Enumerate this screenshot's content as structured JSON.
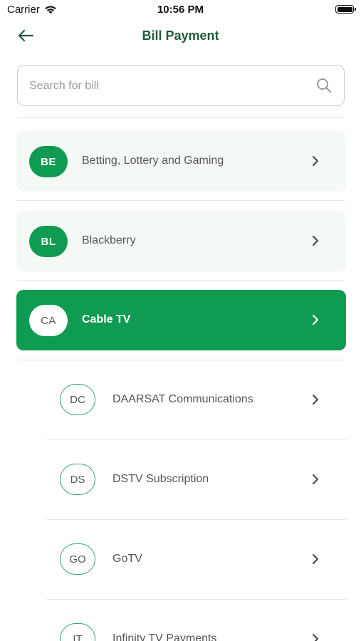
{
  "status_bar": {
    "carrier": "Carrier",
    "time": "10:56 PM"
  },
  "nav": {
    "title": "Bill Payment"
  },
  "search": {
    "placeholder": "Search for bill"
  },
  "categories": [
    {
      "code": "BE",
      "label": "Betting, Lottery and Gaming"
    },
    {
      "code": "BL",
      "label": "Blackberry"
    },
    {
      "code": "CA",
      "label": "Cable TV"
    }
  ],
  "sub_items": [
    {
      "code": "DC",
      "label": "DAARSAT Communications"
    },
    {
      "code": "DS",
      "label": "DSTV Subscription"
    },
    {
      "code": "GO",
      "label": "GoTV"
    },
    {
      "code": "IT",
      "label": "Infinity TV Payments"
    }
  ],
  "colors": {
    "accent": "#0f9b51",
    "title": "#1f5b3c"
  }
}
